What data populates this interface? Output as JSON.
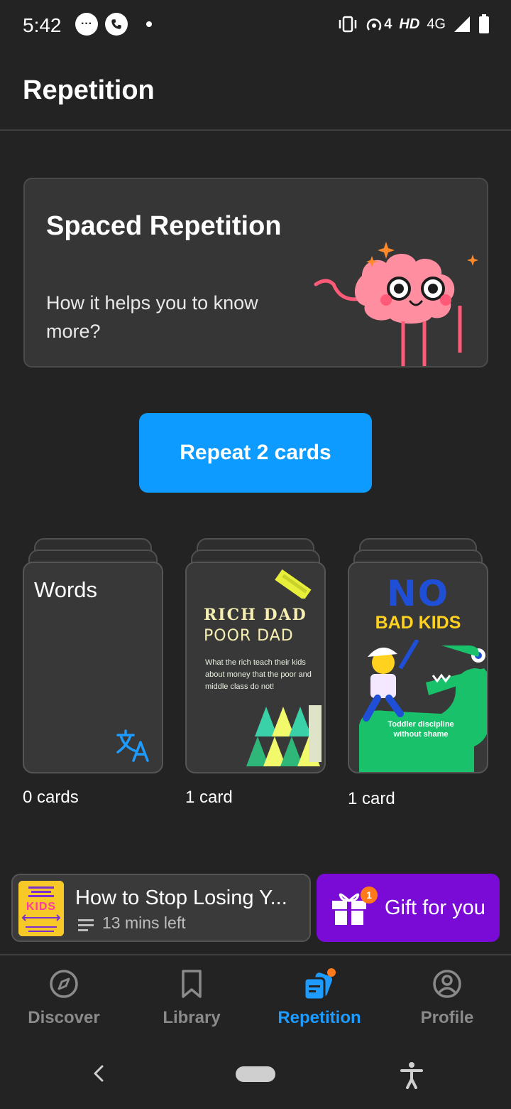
{
  "status_bar": {
    "time": "5:42",
    "network": "4G",
    "hd": "HD",
    "hotspot_count": "4"
  },
  "header": {
    "title": "Repetition"
  },
  "promo": {
    "title": "Spaced Repetition",
    "subtitle": "How it helps you to know more?"
  },
  "repeat_button": {
    "label": "Repeat 2 cards"
  },
  "decks": [
    {
      "title": "Words",
      "count": "0 cards",
      "icon": "translate-icon"
    },
    {
      "cover_title_1": "RICH DAD",
      "cover_title_2": "POOR DAD",
      "cover_blurb": "What the rich teach their kids about money that the poor and middle class do not!",
      "count": "1 card"
    },
    {
      "cover_title_1": "NO",
      "cover_title_2": "BAD KIDS",
      "cover_blurb": "Toddler discipline without shame",
      "count": "1 card"
    }
  ],
  "player": {
    "title": "How to Stop Losing Y...",
    "time_left": "13 mins left",
    "cover_text": "KIDS"
  },
  "gift": {
    "label": "Gift for you",
    "badge": "1"
  },
  "nav": {
    "items": [
      {
        "label": "Discover",
        "icon": "compass-icon",
        "active": false
      },
      {
        "label": "Library",
        "icon": "bookmark-icon",
        "active": false
      },
      {
        "label": "Repetition",
        "icon": "repetition-icon",
        "active": true
      },
      {
        "label": "Profile",
        "icon": "profile-icon",
        "active": false
      }
    ]
  },
  "colors": {
    "background": "#232323",
    "accent": "#0d9bff",
    "gift": "#7a0bd6",
    "card": "#383838"
  }
}
